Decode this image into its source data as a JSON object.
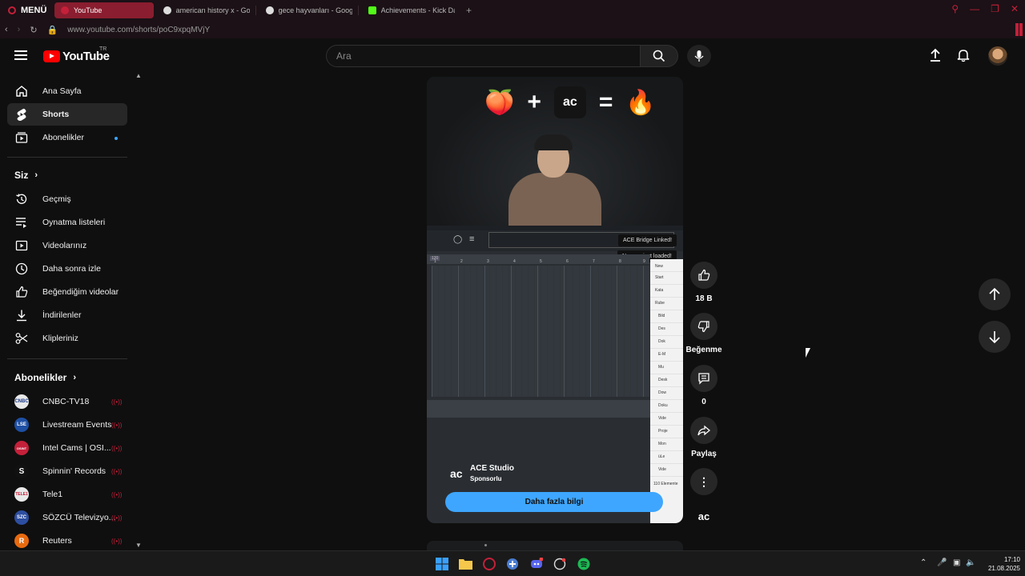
{
  "browser": {
    "menu_label": "MENÜ",
    "tabs": [
      {
        "label": "YouTube",
        "active": true
      },
      {
        "label": "american history x - Goog",
        "active": false
      },
      {
        "label": "gece hayvanları - Google",
        "active": false
      },
      {
        "label": "Achievements - Kick Dash",
        "active": false
      }
    ],
    "url": "www.youtube.com/shorts/poC9xpqMVjY"
  },
  "header": {
    "logo_text": "YouTube",
    "country": "TR",
    "search_placeholder": "Ara"
  },
  "sidebar": {
    "main": [
      {
        "label": "Ana Sayfa",
        "icon": "home-icon"
      },
      {
        "label": "Shorts",
        "icon": "shorts-icon",
        "active": true
      },
      {
        "label": "Abonelikler",
        "icon": "subscriptions-icon"
      }
    ],
    "you_heading": "Siz",
    "you": [
      {
        "label": "Geçmiş",
        "icon": "history-icon"
      },
      {
        "label": "Oynatma listeleri",
        "icon": "playlists-icon"
      },
      {
        "label": "Videolarınız",
        "icon": "your-videos-icon"
      },
      {
        "label": "Daha sonra izle",
        "icon": "watch-later-icon"
      },
      {
        "label": "Beğendiğim videolar",
        "icon": "liked-icon"
      },
      {
        "label": "İndirilenler",
        "icon": "download-icon"
      },
      {
        "label": "Klipleriniz",
        "icon": "clips-icon"
      }
    ],
    "subs_heading": "Abonelikler",
    "subs": [
      {
        "label": "CNBC-TV18",
        "avatar_text": "CNBC",
        "color": "#e9e9e9"
      },
      {
        "label": "Livestream Events",
        "avatar_text": "LSE",
        "color": "#1e4fa3"
      },
      {
        "label": "Intel Cams | OSI...",
        "avatar_text": "OSINT",
        "color": "#c4203a"
      },
      {
        "label": "Spinnin' Records",
        "avatar_text": "S",
        "color": "#111111"
      },
      {
        "label": "Tele1",
        "avatar_text": "TELE1",
        "color": "#e9e9e9"
      },
      {
        "label": "SÖZCÜ Televizyo...",
        "avatar_text": "SZC",
        "color": "#2d4ea0"
      },
      {
        "label": "Reuters",
        "avatar_text": "R",
        "color": "#e86a10"
      }
    ]
  },
  "short": {
    "toast_1": "ACE Bridge Linked!",
    "toast_2": "New project loaded!",
    "ruler_marker": "120",
    "ruler_numbers": [
      "1",
      "2",
      "3",
      "4",
      "5",
      "6",
      "7",
      "8",
      "9"
    ],
    "side_items": [
      "New",
      "Start",
      "Kata",
      "Rube",
      "Bild",
      "Des",
      "Dok",
      "E-M",
      "Mu",
      "Desk",
      "Dow",
      "Doku",
      "Vide",
      "Proje",
      "Mon",
      "üLe",
      "Vide"
    ],
    "side_footer": "110 Elemente",
    "sponsor_name": "ACE Studio",
    "sponsor_sub": "Sponsorlu",
    "cta_label": "Daha fazla bilgi",
    "ace_logo_text": "ac"
  },
  "actions": {
    "like_count": "18 B",
    "dislike_label": "Beğenme",
    "comment_count": "0",
    "share_label": "Paylaş"
  },
  "taskbar": {
    "time": "17:10",
    "date": "21.08.2025"
  },
  "colors": {
    "accent": "#3ea6ff",
    "opera_red": "#c4203a",
    "yt_red": "#ff0000"
  }
}
